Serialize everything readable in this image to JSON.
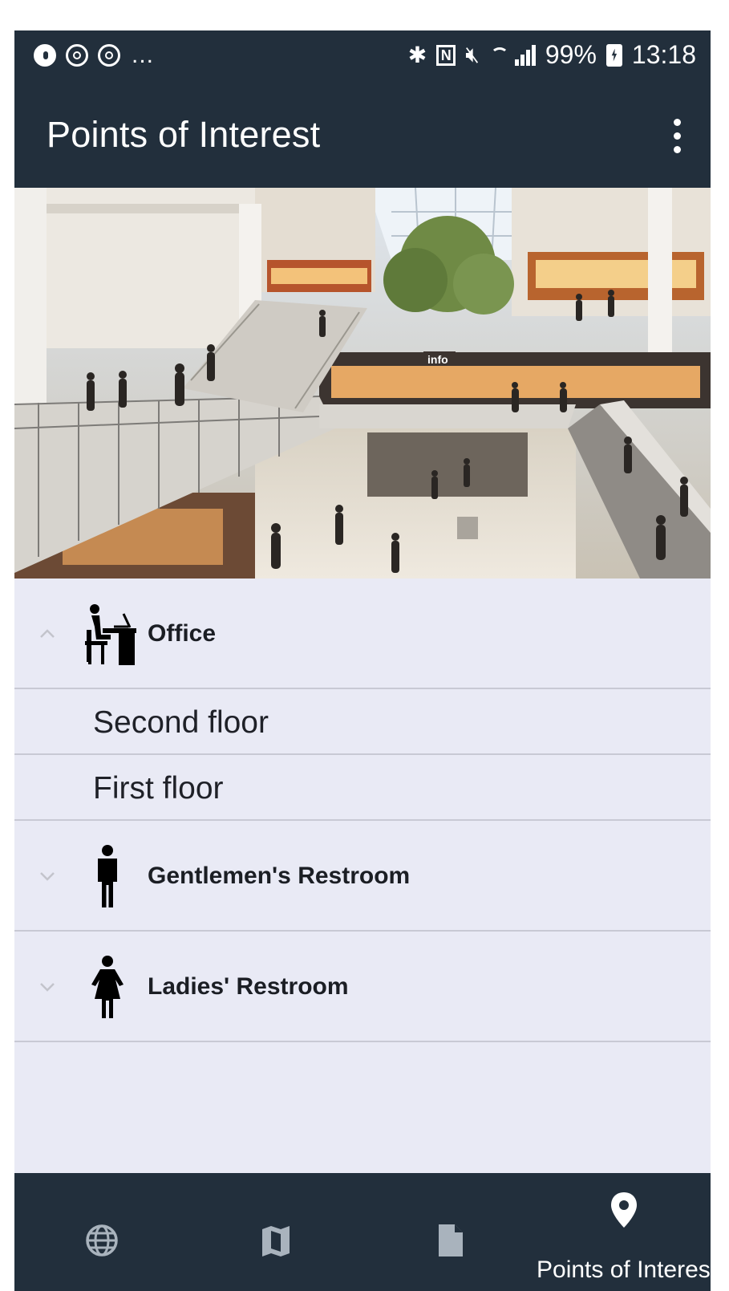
{
  "status_bar": {
    "left_more": "...",
    "nfc": "N",
    "battery_percent": "99%",
    "time": "13:18"
  },
  "app_bar": {
    "title": "Points of Interest"
  },
  "hero": {
    "sign_text": "info"
  },
  "groups": [
    {
      "label": "Office",
      "icon": "office-desk-icon",
      "expanded": true,
      "items": [
        {
          "label": "Second floor"
        },
        {
          "label": "First floor"
        }
      ]
    },
    {
      "label": "Gentlemen's Restroom",
      "icon": "man-icon",
      "expanded": false,
      "items": []
    },
    {
      "label": "Ladies' Restroom",
      "icon": "woman-icon",
      "expanded": false,
      "items": []
    }
  ],
  "bottom_nav": {
    "items": [
      {
        "icon": "globe-icon",
        "label": ""
      },
      {
        "icon": "map-icon",
        "label": ""
      },
      {
        "icon": "document-icon",
        "label": ""
      },
      {
        "icon": "location-pin-icon",
        "label": "Points of Interest",
        "active": true
      }
    ]
  },
  "colors": {
    "bar_background": "#222f3c",
    "list_background": "#e9eaf5",
    "divider": "#c8c9d4"
  }
}
